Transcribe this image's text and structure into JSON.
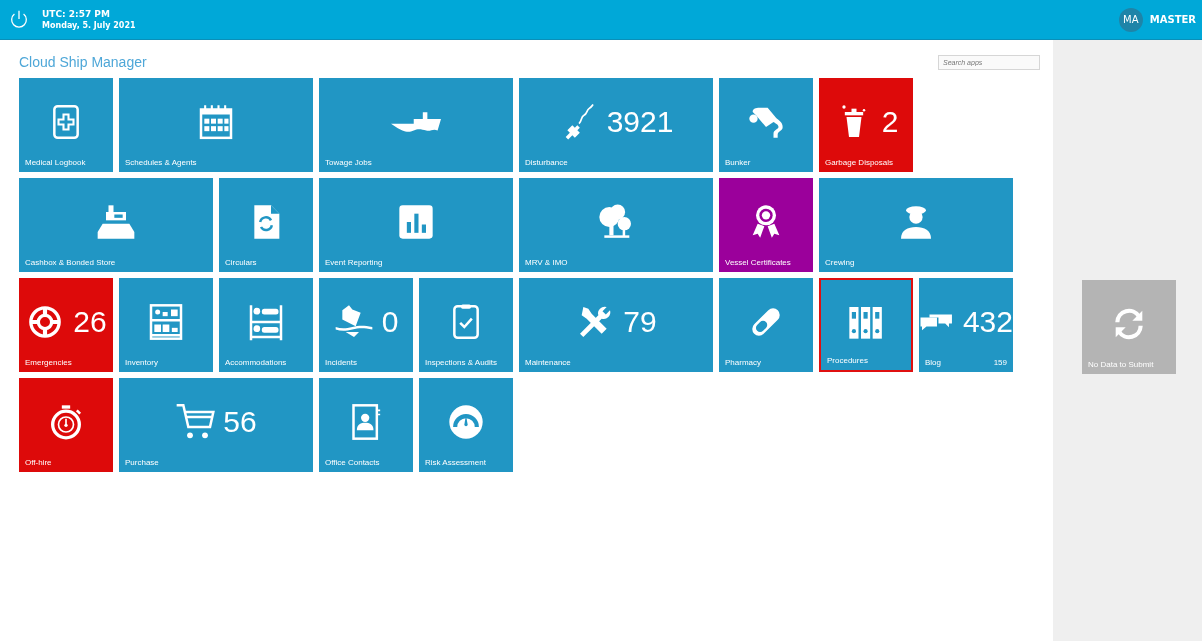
{
  "top_bar": {
    "time": "UTC: 2:57 PM",
    "date": "Monday, 5. July 2021",
    "avatar": "MA",
    "user": "MASTER"
  },
  "title": "Cloud Ship Manager",
  "search": {
    "placeholder": "Search apps"
  },
  "tile_rows": [
    [
      {
        "label": "Medical Logbook",
        "kind": "small",
        "color": "#2196c4",
        "selected": false
      },
      {
        "label": "Schedules & Agents",
        "kind": "wide",
        "color": "#2196c4",
        "selected": false
      },
      {
        "label": "Towage Jobs",
        "kind": "wide",
        "color": "#2196c4",
        "selected": false
      },
      {
        "label": "Disturbance",
        "kind": "wide",
        "color": "#2196c4",
        "count": "3921",
        "selected": false
      },
      {
        "label": "Bunker",
        "kind": "small",
        "color": "#2196c4",
        "selected": false
      },
      {
        "label": "Garbage Disposals",
        "kind": "small",
        "color": "#dd0a0a",
        "count": "2",
        "selected": false
      }
    ],
    [
      {
        "label": "Cashbox & Bonded Store",
        "kind": "wide",
        "color": "#2196c4",
        "selected": false
      },
      {
        "label": "Circulars",
        "kind": "small",
        "color": "#2196c4",
        "selected": false
      },
      {
        "label": "Event Reporting",
        "kind": "wide",
        "color": "#2196c4",
        "selected": false
      },
      {
        "label": "MRV & IMO",
        "kind": "wide",
        "color": "#2196c4",
        "selected": false
      },
      {
        "label": "Vessel Certificates",
        "kind": "small",
        "color": "#9b009b",
        "selected": false
      },
      {
        "label": "Crewing",
        "kind": "wide",
        "color": "#2196c4",
        "selected": false
      }
    ],
    [
      {
        "label": "Emergencies",
        "kind": "small",
        "color": "#dd0a0a",
        "count": "26",
        "selected": false
      },
      {
        "label": "Inventory",
        "kind": "small",
        "color": "#2196c4",
        "selected": false
      },
      {
        "label": "Accommodations",
        "kind": "small",
        "color": "#2196c4",
        "selected": false
      },
      {
        "label": "Incidents",
        "kind": "small",
        "color": "#2196c4",
        "count": "0",
        "selected": false
      },
      {
        "label": "Inspections & Audits",
        "kind": "small",
        "color": "#2196c4",
        "selected": false
      },
      {
        "label": "Maintenance",
        "kind": "wide",
        "color": "#2196c4",
        "count": "79",
        "selected": false
      },
      {
        "label": "Pharmacy",
        "kind": "small",
        "color": "#2196c4",
        "selected": false
      },
      {
        "label": "Procedures",
        "kind": "small",
        "color": "#2196c4",
        "selected": true
      },
      {
        "label": "Blog",
        "kind": "small",
        "color": "#2196c4",
        "count": "432",
        "sub_count": "159",
        "selected": false
      }
    ],
    [
      {
        "label": "Off-hire",
        "kind": "small",
        "color": "#dd0a0a",
        "selected": false
      },
      {
        "label": "Purchase",
        "kind": "wide",
        "color": "#2196c4",
        "count": "56",
        "selected": false
      },
      {
        "label": "Office Contacts",
        "kind": "small",
        "color": "#2196c4",
        "selected": false
      },
      {
        "label": "Risk Assessment",
        "kind": "small",
        "color": "#2196c4",
        "selected": false
      }
    ]
  ],
  "side_panel": {
    "sync_tile": {
      "label": "No Data to Submit",
      "disabled": true
    }
  }
}
